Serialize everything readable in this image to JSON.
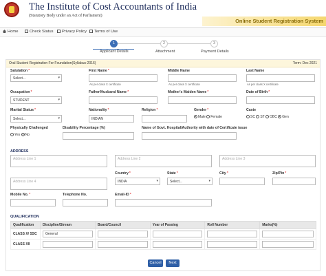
{
  "header": {
    "title": "The Institute of Cost Accountants of India",
    "subtitle": "(Statutory Body under an Act of Parliament)",
    "banner": "Online Student Registration System",
    "brand_color": "#1c2b5a"
  },
  "nav": {
    "home": "Home",
    "check_status": "Check Status",
    "privacy": "Privacy Policy",
    "terms": "Terms of Use"
  },
  "steps": [
    {
      "num": "1",
      "label": "Applicant Details",
      "active": true
    },
    {
      "num": "2",
      "label": "Attachment",
      "active": false
    },
    {
      "num": "3",
      "label": "Payment Details",
      "active": false
    }
  ],
  "band": {
    "left": "Oral Student Registration For Foundation(Syllabus-2016)",
    "right": "Term: Dec 2021"
  },
  "form": {
    "salutation": {
      "label": "Salutation",
      "value": "Select..."
    },
    "first_name": {
      "label": "First Name",
      "hint": "As per class X certificate"
    },
    "middle_name": {
      "label": "Middle Name",
      "hint": "As per class X certificate"
    },
    "last_name": {
      "label": "Last Name",
      "hint": "As per class X certificate"
    },
    "occupation": {
      "label": "Occupation",
      "value": "STUDENT"
    },
    "father_name": {
      "label": "Father/Husband Name"
    },
    "mother_name": {
      "label": "Mother's Maiden Name"
    },
    "dob": {
      "label": "Date of Birth"
    },
    "marital": {
      "label": "Marital Status",
      "value": "Select..."
    },
    "nationality": {
      "label": "Nationality",
      "value": "INDIAN"
    },
    "religion": {
      "label": "Religion"
    },
    "gender": {
      "label": "Gender",
      "options": [
        "Male",
        "Female"
      ],
      "selected": "Male"
    },
    "caste": {
      "label": "Caste",
      "options": [
        "SC",
        "ST",
        "OBC",
        "Gen"
      ],
      "selected": "Gen"
    },
    "physically": {
      "label": "Physically Challenged",
      "options": [
        "Yes",
        "No"
      ],
      "selected": "No"
    },
    "disability": {
      "label": "Disability Percentage (%)"
    },
    "hospital": {
      "label": "Name of Govt. Hospital/Authority with date of Certificate issue"
    }
  },
  "address": {
    "section": "ADDRESS",
    "line1": "Address Line 1",
    "line2": "Address Line 2",
    "line3": "Address Line 3",
    "line4": "Address Line 4",
    "country": {
      "label": "Country",
      "value": "INDIA"
    },
    "state": {
      "label": "State",
      "value": "Select..."
    },
    "city": {
      "label": "City"
    },
    "pin": {
      "label": "Zip/Pin"
    },
    "mobile": {
      "label": "Mobile No."
    },
    "telephone": {
      "label": "Telephone No."
    },
    "email": {
      "label": "Email-ID"
    }
  },
  "qualification": {
    "section": "QUALIFICATION",
    "columns": [
      "Qualification",
      "Discipline/Stream",
      "Board/Council",
      "Year of Passing",
      "Roll Number",
      "Marks(%)"
    ],
    "rows": [
      {
        "name": "CLASS X/ SSC",
        "stream": "General"
      },
      {
        "name": "CLASS XII",
        "stream": ""
      }
    ]
  },
  "buttons": {
    "cancel": "Cancel",
    "next": "Next"
  }
}
